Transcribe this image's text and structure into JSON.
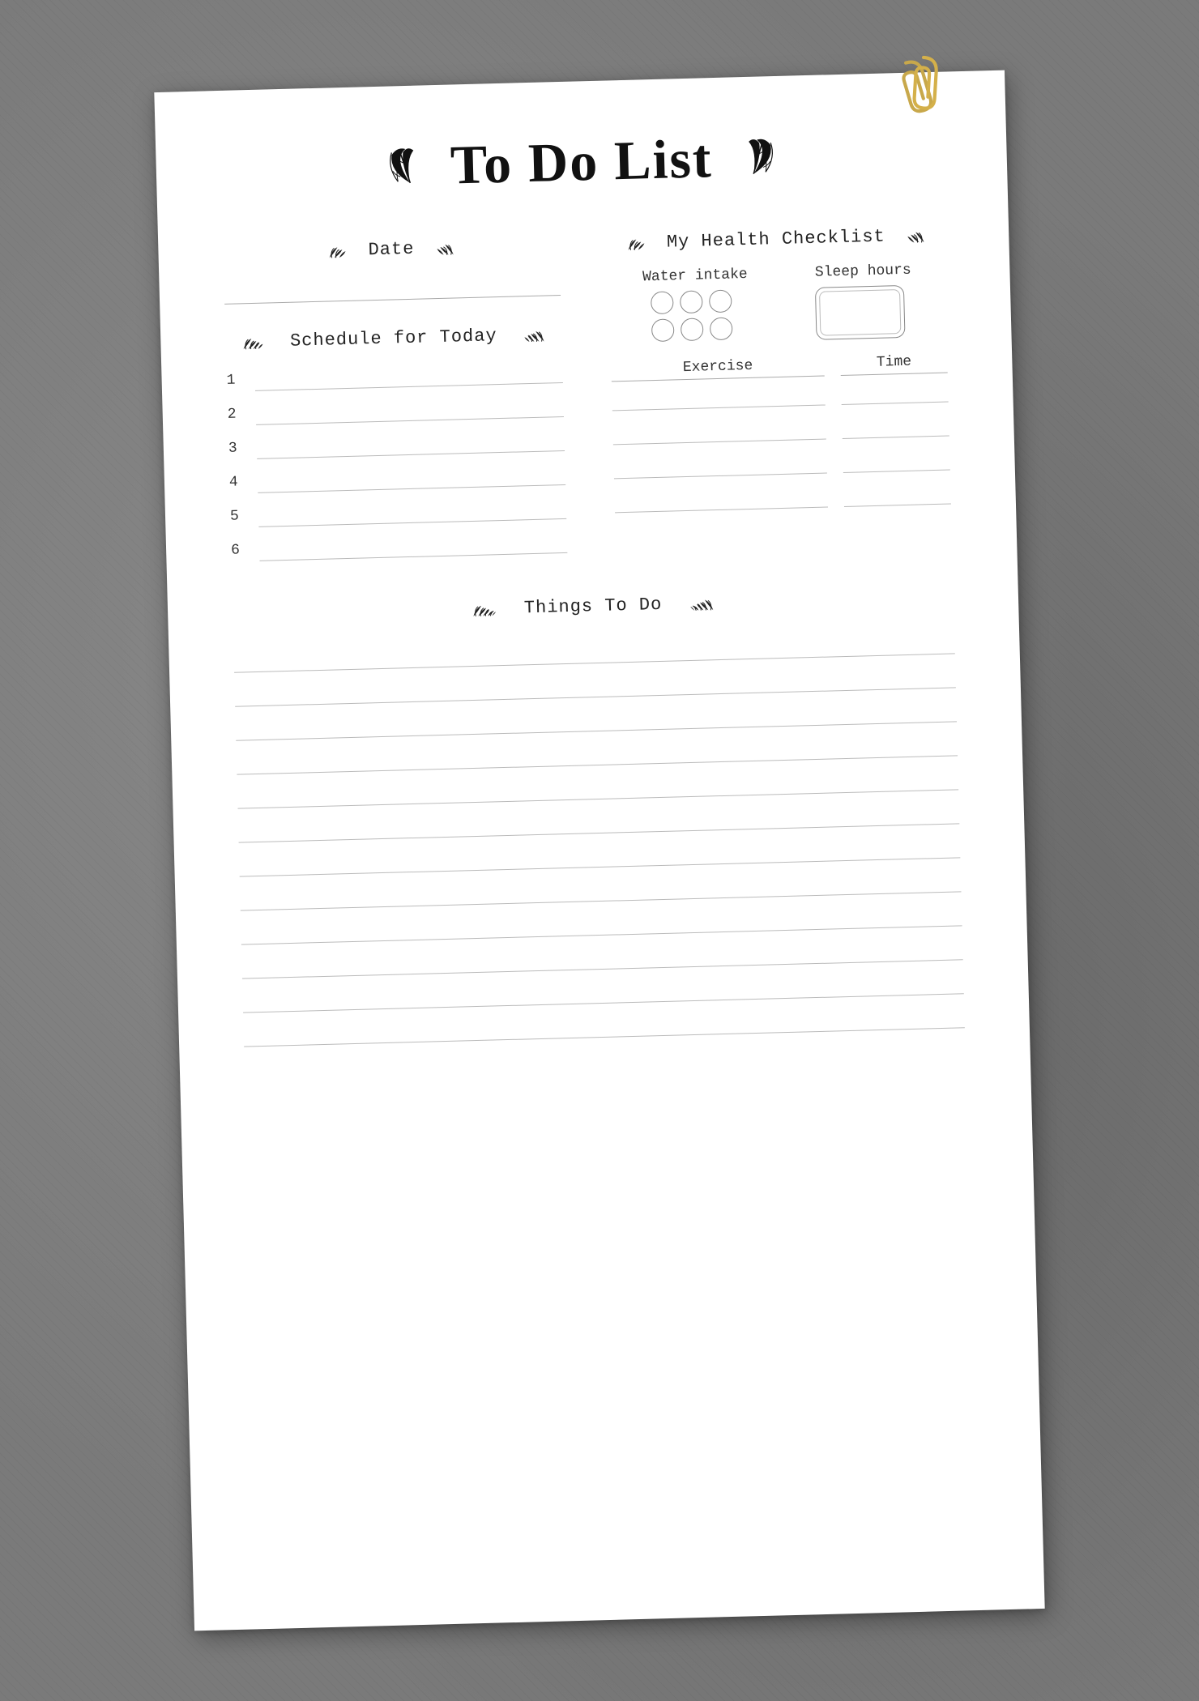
{
  "page": {
    "title": "To Do List",
    "date_section": {
      "label": "Date",
      "laurel_left": "🌿",
      "laurel_right": "🌿"
    },
    "health_checklist": {
      "label": "My Health Checklist",
      "water_label": "Water intake",
      "sleep_label": "Sleep hours",
      "exercise_label": "Exercise",
      "time_label": "Time",
      "water_circles": 6,
      "exercise_rows": 4
    },
    "schedule": {
      "label": "Schedule for Today",
      "items": [
        "1",
        "2",
        "3",
        "4",
        "5",
        "6"
      ]
    },
    "things_to_do": {
      "label": "Things To Do",
      "line_count": 12
    }
  }
}
